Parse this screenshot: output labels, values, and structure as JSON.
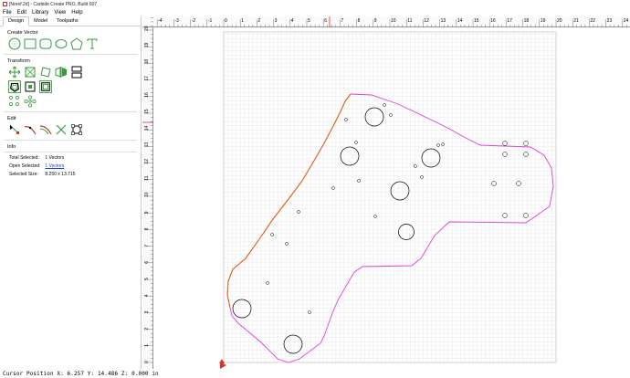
{
  "window": {
    "title": "[Nreef.2d] - Carbide Create PRO, Build 607"
  },
  "menu": [
    "File",
    "Edit",
    "Library",
    "View",
    "Help"
  ],
  "tabs": [
    "Design",
    "Model",
    "Toolpaths"
  ],
  "sections": {
    "create_vector": "Create Vector",
    "transform": "Transform",
    "edit": "Edit",
    "info": "Info"
  },
  "info": {
    "total_selected_label": "Total Selected:",
    "total_selected_value": "1 Vectors",
    "open_selected_label": "Open Selected:",
    "open_selected_value": "1 Vectors",
    "selected_size_label": "Selected Size:",
    "selected_size_value": "8.250 x 13.715"
  },
  "rulers": {
    "x_ticks": [
      "-4",
      "-3",
      "-2",
      "-1",
      "0",
      "1",
      "2",
      "3",
      "4",
      "5",
      "6",
      "7",
      "8",
      "9",
      "10",
      "11",
      "12",
      "13",
      "14",
      "15",
      "16",
      "17",
      "18",
      "19",
      "20",
      "21",
      "22",
      "23",
      "24"
    ],
    "y_ticks": [
      "0",
      "1",
      "2",
      "3",
      "4",
      "5",
      "6",
      "7",
      "8",
      "9",
      "10",
      "11",
      "12",
      "13",
      "14",
      "15",
      "16",
      "17",
      "18",
      "19",
      "20"
    ]
  },
  "status": {
    "text": "Cursor Position X: 6.257 Y: 14.486 Z: 0.000 in"
  },
  "colors": {
    "accent": "#3a9a3a",
    "selected_path": "#e05a10",
    "path": "#e040e0",
    "grid": "#d8d8d8",
    "link": "#1a3fcc"
  }
}
